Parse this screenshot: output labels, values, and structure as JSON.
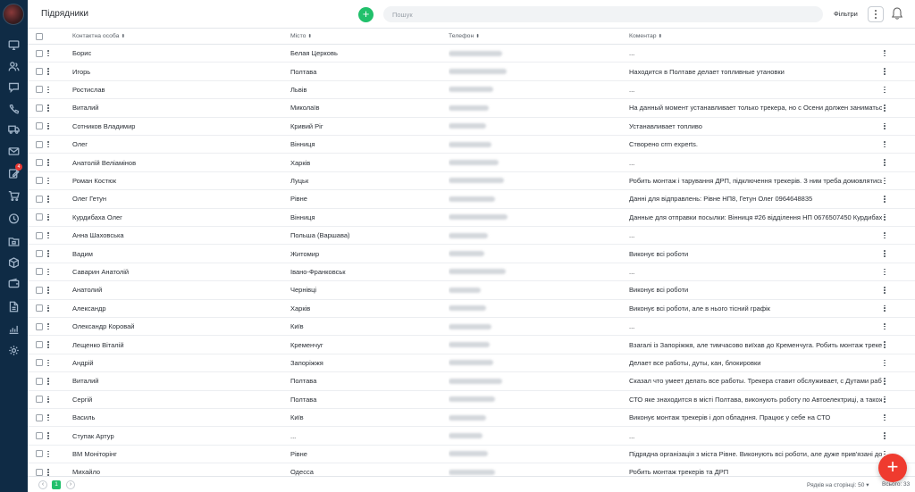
{
  "header": {
    "title": "Підрядники",
    "add_label": "+",
    "search_placeholder": "Пошук",
    "filters_label": "Фільтри"
  },
  "sidebar": {
    "items": [
      {
        "icon": "monitor-icon"
      },
      {
        "icon": "users-icon"
      },
      {
        "icon": "chat-icon"
      },
      {
        "icon": "phone-icon"
      },
      {
        "icon": "truck-icon"
      },
      {
        "icon": "mail-icon"
      },
      {
        "icon": "edit-icon",
        "badge": "4"
      },
      {
        "icon": "cart-icon"
      },
      {
        "icon": "clock-icon"
      },
      {
        "icon": "folder-icon"
      },
      {
        "icon": "box-icon"
      },
      {
        "icon": "wallet-icon"
      },
      {
        "icon": "document-icon"
      },
      {
        "icon": "chart-icon"
      },
      {
        "icon": "gear-icon"
      }
    ]
  },
  "table": {
    "columns": [
      "Контактна особа",
      "Місто",
      "Телефон",
      "Коментар"
    ],
    "sort_glyph": "⬍",
    "rows": [
      {
        "name": "Борис",
        "city": "Белая Церковь",
        "comment": "..."
      },
      {
        "name": "Игорь",
        "city": "Полтава",
        "comment": "Находится в Полтаве делает топливные утановки"
      },
      {
        "name": "Ростислав",
        "city": "Львів",
        "comment": "..."
      },
      {
        "name": "Виталий",
        "city": "Миколаїв",
        "comment": "На данный момент устанавливает только трекера, но с Осени должен заниматься и ус"
      },
      {
        "name": "Сотников Владимир",
        "city": "Кривий Ріг",
        "comment": "Устанавливает топливо"
      },
      {
        "name": "Олег",
        "city": "Вінниця",
        "comment": "Створено crm experts."
      },
      {
        "name": "Анатолій Веліамінов",
        "city": "Харків",
        "comment": "..."
      },
      {
        "name": "Роман Костюк",
        "city": "Луцьк",
        "comment": "Робить монтаж і тарування ДРП, підключення трекерів. З ним треба домовлятись захв"
      },
      {
        "name": "Олег Гетун",
        "city": "Рівне",
        "comment": "Данні для відправлень: Рівне НП8, Гетун Олег 0964648835"
      },
      {
        "name": "Курдибаха Олег",
        "city": "Вінниця",
        "comment": "Данные для отправки посылки: Вінниця #26 відділення НП 0676507450 Курдибаха Оле"
      },
      {
        "name": "Анна Шаховська",
        "city": "Польша (Варшава)",
        "comment": "..."
      },
      {
        "name": "Вадим",
        "city": "Житомир",
        "comment": "Виконує всі роботи"
      },
      {
        "name": "Саварин Анатолій",
        "city": "Івано-Франковськ",
        "comment": "..."
      },
      {
        "name": "Анатолий",
        "city": "Чернівці",
        "comment": "Виконує всі роботи"
      },
      {
        "name": "Александр",
        "city": "Харків",
        "comment": "Виконує всі роботи, але в нього тісний графік"
      },
      {
        "name": "Олександр Коровай",
        "city": "Київ",
        "comment": "..."
      },
      {
        "name": "Лещенко Віталій",
        "city": "Кременчуг",
        "comment": "Взагалі із Запоріжжя, але тимчасово виїхав до Кременчуга. Робить монтаж трекерів"
      },
      {
        "name": "Андрій",
        "city": "Запоріжжя",
        "comment": "Делает все работы, дуты, кан, блокировки"
      },
      {
        "name": "Виталий",
        "city": "Полтава",
        "comment": "Сказал что умеет делать все работы. Трекера ставит обслуживает, с Дутами работает"
      },
      {
        "name": "Сергій",
        "city": "Полтава",
        "comment": "СТО яке знаходится в місті Полтава, виконують роботу по Автоелектриці, а також монт"
      },
      {
        "name": "Василь",
        "city": "Київ",
        "comment": "Виконує монтаж трекерів і доп обладння. Працює у себе на СТО"
      },
      {
        "name": "Ступак Артур",
        "city": "...",
        "comment": "..."
      },
      {
        "name": "ВМ Моніторінг",
        "city": "Рівне",
        "comment": "Підрядна організація з міста Рівне. Виконують всі роботи, але дуже прив'язані до свят"
      },
      {
        "name": "Михайло",
        "city": "Одесса",
        "comment": "Робить монтаж трекерів та ДРП"
      }
    ]
  },
  "footer": {
    "page": "1",
    "rows_per_page": "Рядків на сторінці: 50 ▾",
    "total": "Всього: 33"
  },
  "colors": {
    "sidebar": "#0f2b45",
    "accent_green": "#21c06b",
    "fab_red": "#ef3b2f"
  }
}
